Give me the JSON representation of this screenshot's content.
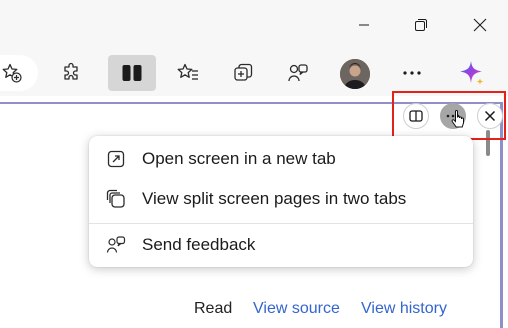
{
  "window_controls": {
    "minimize_icon": "minimize-icon",
    "restore_icon": "restore-icon",
    "close_icon": "close-icon"
  },
  "toolbar": {
    "buttons": [
      {
        "name": "favorite-add-icon"
      },
      {
        "name": "extensions-icon"
      },
      {
        "name": "split-screen-icon",
        "active": true
      },
      {
        "name": "favorites-icon"
      },
      {
        "name": "collections-icon"
      },
      {
        "name": "feedback-icon"
      },
      {
        "name": "profile-avatar"
      },
      {
        "name": "more-icon",
        "label": "···"
      },
      {
        "name": "copilot-icon"
      }
    ]
  },
  "split_controls": {
    "split_icon": "split-view-icon",
    "more_icon": "more-options-icon",
    "close_icon": "close-split-icon"
  },
  "menu": {
    "items": [
      {
        "label": "Open screen in a new tab",
        "icon": "open-in-new-tab-icon"
      },
      {
        "label": "View split screen pages in two tabs",
        "icon": "pages-in-tabs-icon"
      },
      {
        "label": "Send feedback",
        "icon": "feedback-icon"
      }
    ]
  },
  "page_tabs": {
    "read": "Read",
    "view_source": "View source",
    "view_history": "View history"
  },
  "colors": {
    "highlight": "#e2231a",
    "link": "#3366cc",
    "frame": "#8f8fc9"
  }
}
